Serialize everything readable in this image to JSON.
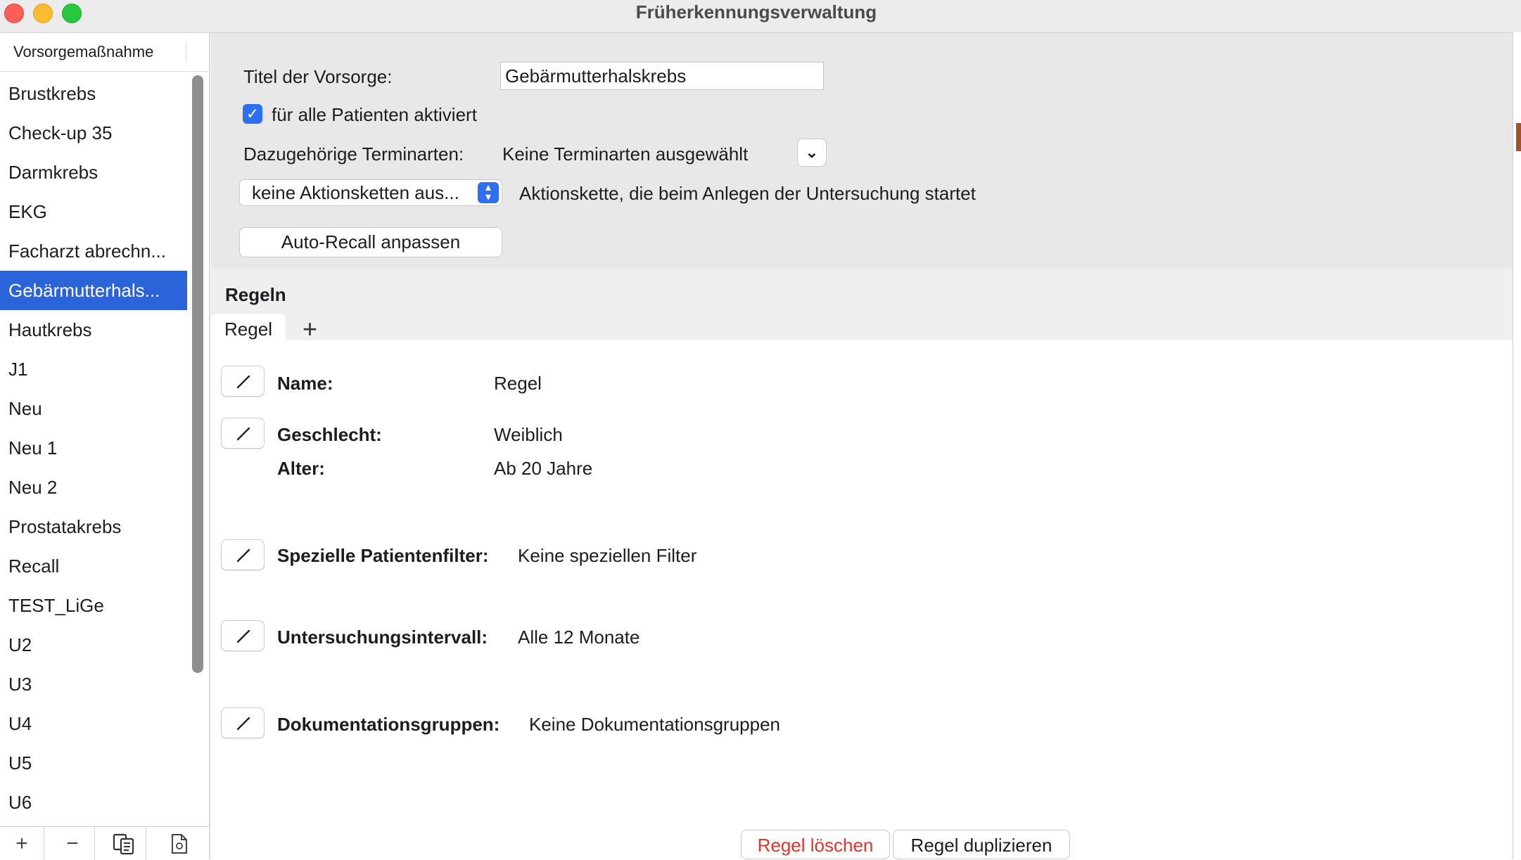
{
  "window": {
    "title": "Früherkennungsverwaltung"
  },
  "sidebar": {
    "header": "Vorsorgemaßnahme",
    "items": [
      {
        "label": "Brustkrebs"
      },
      {
        "label": "Check-up 35"
      },
      {
        "label": "Darmkrebs"
      },
      {
        "label": "EKG"
      },
      {
        "label": "Facharzt abrechn..."
      },
      {
        "label": "Gebärmutterhals..."
      },
      {
        "label": "Hautkrebs"
      },
      {
        "label": "J1"
      },
      {
        "label": "Neu"
      },
      {
        "label": "Neu 1"
      },
      {
        "label": "Neu 2"
      },
      {
        "label": "Prostatakrebs"
      },
      {
        "label": "Recall"
      },
      {
        "label": "TEST_LiGe"
      },
      {
        "label": "U2"
      },
      {
        "label": "U3"
      },
      {
        "label": "U4"
      },
      {
        "label": "U5"
      },
      {
        "label": "U6"
      }
    ],
    "selected_index": 5,
    "toolbar": {
      "add": "+",
      "remove": "−",
      "copy_icon": "copy-icon",
      "import_icon": "document-icon"
    }
  },
  "form": {
    "title_label": "Titel der Vorsorge:",
    "title_value": "Gebärmutterhalskrebs",
    "checkbox_label": "für alle Patienten aktiviert",
    "checkbox_checked": true,
    "appt_types_label": "Dazugehörige Terminarten:",
    "appt_types_value": "Keine Terminarten ausgewählt",
    "action_chain_value": "keine Aktionsketten aus...",
    "action_chain_desc": "Aktionskette, die beim Anlegen der Untersuchung startet",
    "auto_recall_button": "Auto-Recall anpassen"
  },
  "rules": {
    "heading": "Regeln",
    "tabs": [
      {
        "label": "Regel"
      }
    ],
    "add_tab": "+",
    "fields": {
      "name_label": "Name:",
      "name_value": "Regel",
      "gender_label": "Geschlecht:",
      "gender_value": "Weiblich",
      "age_label": "Alter:",
      "age_value": "Ab 20 Jahre",
      "filter_label": "Spezielle Patientenfilter:",
      "filter_value": "Keine speziellen Filter",
      "interval_label": "Untersuchungsintervall:",
      "interval_value": "Alle 12 Monate",
      "docs_label": "Dokumentationsgruppen:",
      "docs_value": "Keine Dokumentationsgruppen"
    },
    "delete_button": "Regel löschen",
    "duplicate_button": "Regel duplizieren"
  },
  "colors": {
    "accent": "#2b63d9",
    "delete_text": "#e0352b"
  }
}
